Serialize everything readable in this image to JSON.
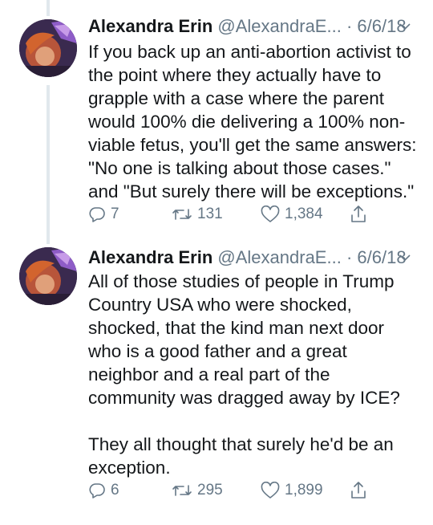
{
  "tweets": [
    {
      "author": "Alexandra Erin",
      "handle": "@AlexandraE...",
      "separator": "·",
      "date": "6/6/18",
      "lines": [
        "If you back up an anti-abortion activist to",
        "the point where they actually have to",
        "grapple with a case where the parent",
        "would 100% die delivering a 100% non-",
        "viable fetus, you'll get the same answers:",
        "\"No one is talking about those cases.\"",
        "and \"But surely there will be exceptions.\""
      ],
      "replies": "7",
      "retweets": "131",
      "likes": "1,384"
    },
    {
      "author": "Alexandra Erin",
      "handle": "@AlexandraE...",
      "separator": "·",
      "date": "6/6/18",
      "lines": [
        "All of those studies of people in Trump",
        "Country USA who were shocked,",
        "shocked, that the kind man next door",
        "who is a good father and a great",
        "neighbor and a real part of the",
        "community was dragged away by ICE?",
        "",
        "They all thought that surely he'd be an",
        "exception."
      ],
      "replies": "6",
      "retweets": "295",
      "likes": "1,899"
    }
  ],
  "icons": {
    "reply": "reply-icon",
    "retweet": "retweet-icon",
    "like": "heart-icon",
    "share": "share-icon",
    "caret": "chevron-down-icon"
  },
  "colors": {
    "text": "#14171a",
    "muted": "#657786",
    "thread_line": "#e1e8ed"
  }
}
